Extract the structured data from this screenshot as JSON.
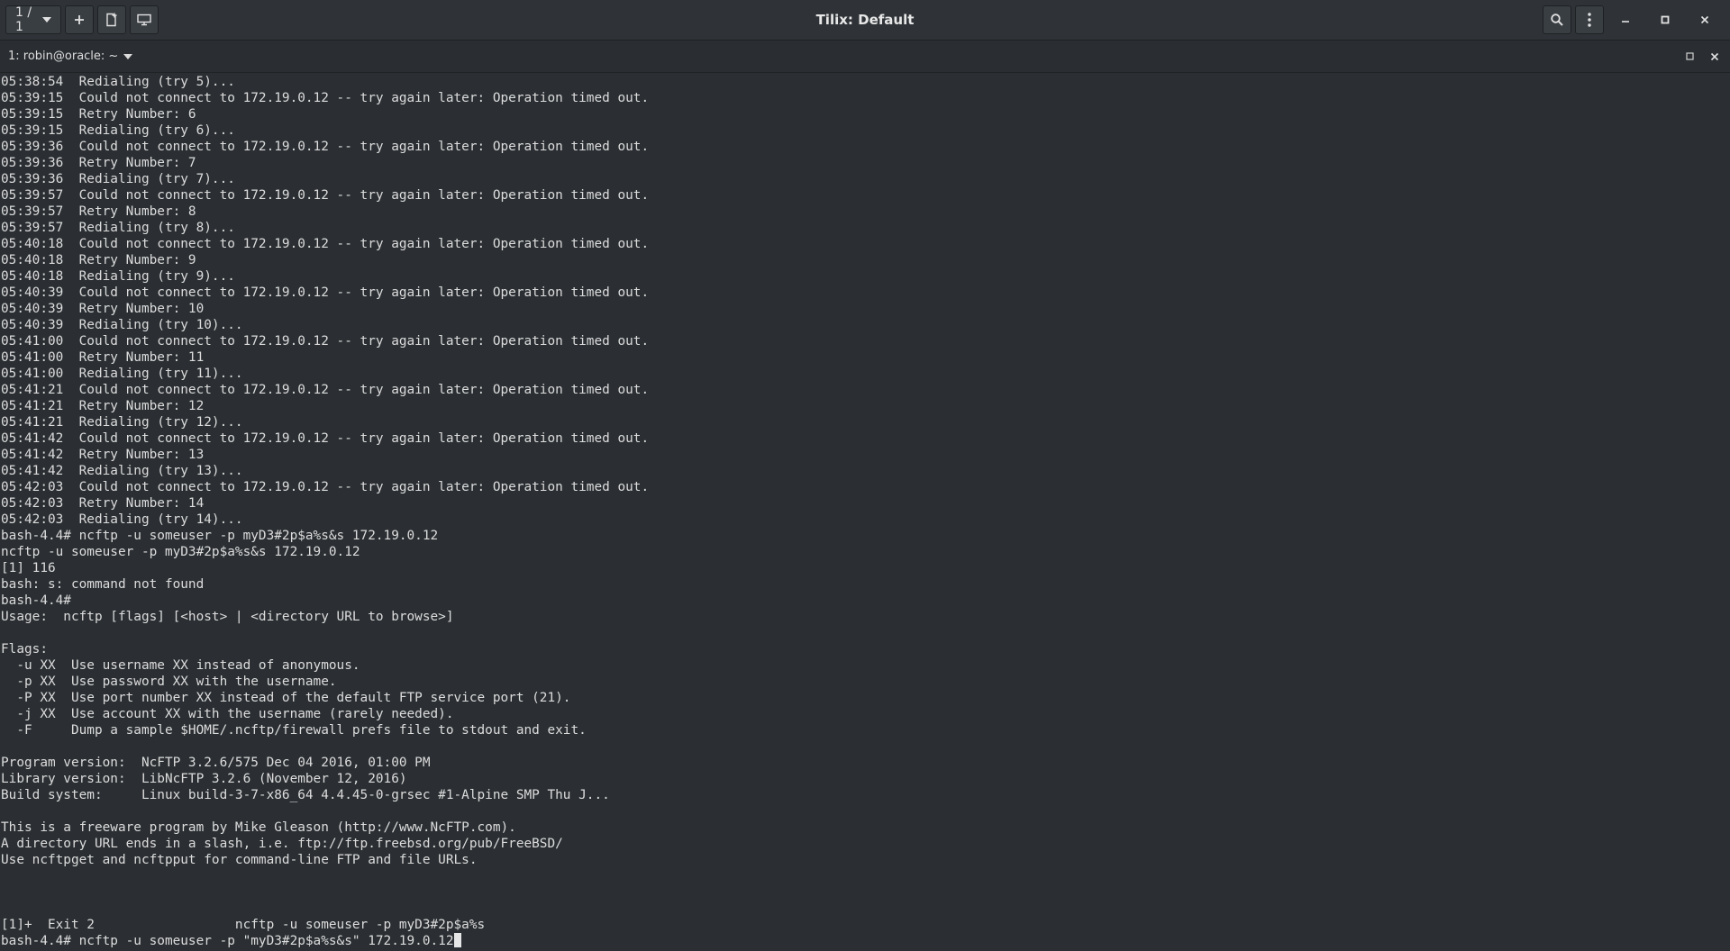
{
  "header": {
    "session_label": "1 / 1",
    "title": "Tilix: Default",
    "icons": {
      "session_dropdown": "chevron-down-icon",
      "add_session": "plus-icon",
      "new_session": "new-session-icon",
      "sync_input": "terminal-overlay-icon",
      "search": "search-icon",
      "menu": "kebab-menu-icon",
      "minimize": "minimize-icon",
      "maximize": "maximize-icon",
      "close": "close-icon"
    }
  },
  "terminal_titlebar": {
    "title": "1: robin@oracle: ~",
    "icons": {
      "dropdown": "chevron-down-icon",
      "maximize": "maximize-icon",
      "close": "close-icon"
    }
  },
  "terminal": {
    "lines": [
      "05:38:54  Redialing (try 5)...",
      "05:39:15  Could not connect to 172.19.0.12 -- try again later: Operation timed out.",
      "05:39:15  Retry Number: 6",
      "05:39:15  Redialing (try 6)...",
      "05:39:36  Could not connect to 172.19.0.12 -- try again later: Operation timed out.",
      "05:39:36  Retry Number: 7",
      "05:39:36  Redialing (try 7)...",
      "05:39:57  Could not connect to 172.19.0.12 -- try again later: Operation timed out.",
      "05:39:57  Retry Number: 8",
      "05:39:57  Redialing (try 8)...",
      "05:40:18  Could not connect to 172.19.0.12 -- try again later: Operation timed out.",
      "05:40:18  Retry Number: 9",
      "05:40:18  Redialing (try 9)...",
      "05:40:39  Could not connect to 172.19.0.12 -- try again later: Operation timed out.",
      "05:40:39  Retry Number: 10",
      "05:40:39  Redialing (try 10)...",
      "05:41:00  Could not connect to 172.19.0.12 -- try again later: Operation timed out.",
      "05:41:00  Retry Number: 11",
      "05:41:00  Redialing (try 11)...",
      "05:41:21  Could not connect to 172.19.0.12 -- try again later: Operation timed out.",
      "05:41:21  Retry Number: 12",
      "05:41:21  Redialing (try 12)...",
      "05:41:42  Could not connect to 172.19.0.12 -- try again later: Operation timed out.",
      "05:41:42  Retry Number: 13",
      "05:41:42  Redialing (try 13)...",
      "05:42:03  Could not connect to 172.19.0.12 -- try again later: Operation timed out.",
      "05:42:03  Retry Number: 14",
      "05:42:03  Redialing (try 14)...",
      "bash-4.4# ncftp -u someuser -p myD3#2p$a%s&s 172.19.0.12",
      "ncftp -u someuser -p myD3#2p$a%s&s 172.19.0.12",
      "[1] 116",
      "bash: s: command not found",
      "bash-4.4#",
      "Usage:  ncftp [flags] [<host> | <directory URL to browse>]",
      "",
      "Flags:",
      "  -u XX  Use username XX instead of anonymous.",
      "  -p XX  Use password XX with the username.",
      "  -P XX  Use port number XX instead of the default FTP service port (21).",
      "  -j XX  Use account XX with the username (rarely needed).",
      "  -F     Dump a sample $HOME/.ncftp/firewall prefs file to stdout and exit.",
      "",
      "Program version:  NcFTP 3.2.6/575 Dec 04 2016, 01:00 PM",
      "Library version:  LibNcFTP 3.2.6 (November 12, 2016)",
      "Build system:     Linux build-3-7-x86_64 4.4.45-0-grsec #1-Alpine SMP Thu J...",
      "",
      "This is a freeware program by Mike Gleason (http://www.NcFTP.com).",
      "A directory URL ends in a slash, i.e. ftp://ftp.freebsd.org/pub/FreeBSD/",
      "Use ncftpget and ncftpput for command-line FTP and file URLs.",
      "",
      "",
      "",
      "[1]+  Exit 2                  ncftp -u someuser -p myD3#2p$a%s"
    ],
    "prompt_line": "bash-4.4# ncftp -u someuser -p \"myD3#2p$a%s&s\" 172.19.0.12"
  }
}
